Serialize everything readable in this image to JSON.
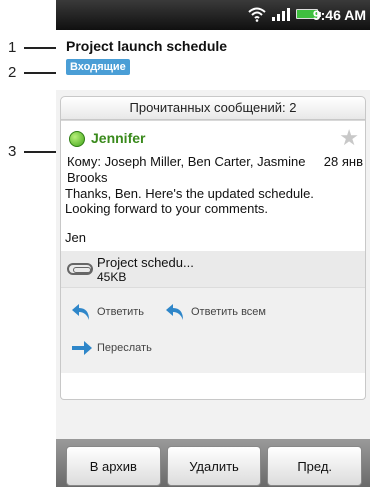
{
  "callouts": [
    {
      "number": "1"
    },
    {
      "number": "2"
    },
    {
      "number": "3"
    }
  ],
  "statusbar": {
    "time": "9:46 AM",
    "icons": [
      "wifi-icon",
      "signal-icon",
      "battery-icon"
    ]
  },
  "email": {
    "subject": "Project launch schedule",
    "folder_label": "Входящие",
    "read_count_label": "Прочитанных сообщений: 2",
    "sender": "Jennifer",
    "to_line": "Кому: Joseph Miller, Ben Carter, Jasmine",
    "to_line_cont": "Brooks",
    "date": "28 янв",
    "body_line1": "Thanks, Ben. Here's the updated schedule.",
    "body_line2": "Looking forward to your comments.",
    "signature": "Jen",
    "attachment": {
      "name": "Project schedu...",
      "size": "45KB"
    }
  },
  "actions": {
    "reply": "Ответить",
    "reply_all": "Ответить всем",
    "forward": "Переслать"
  },
  "bottom_bar": {
    "archive": "В архив",
    "delete": "Удалить",
    "prev": "Пред."
  },
  "colors": {
    "sender": "#3a8a1c",
    "badge": "#4a9ed6",
    "presence": "#41a51a",
    "action_arrow": "#2e86c9"
  }
}
